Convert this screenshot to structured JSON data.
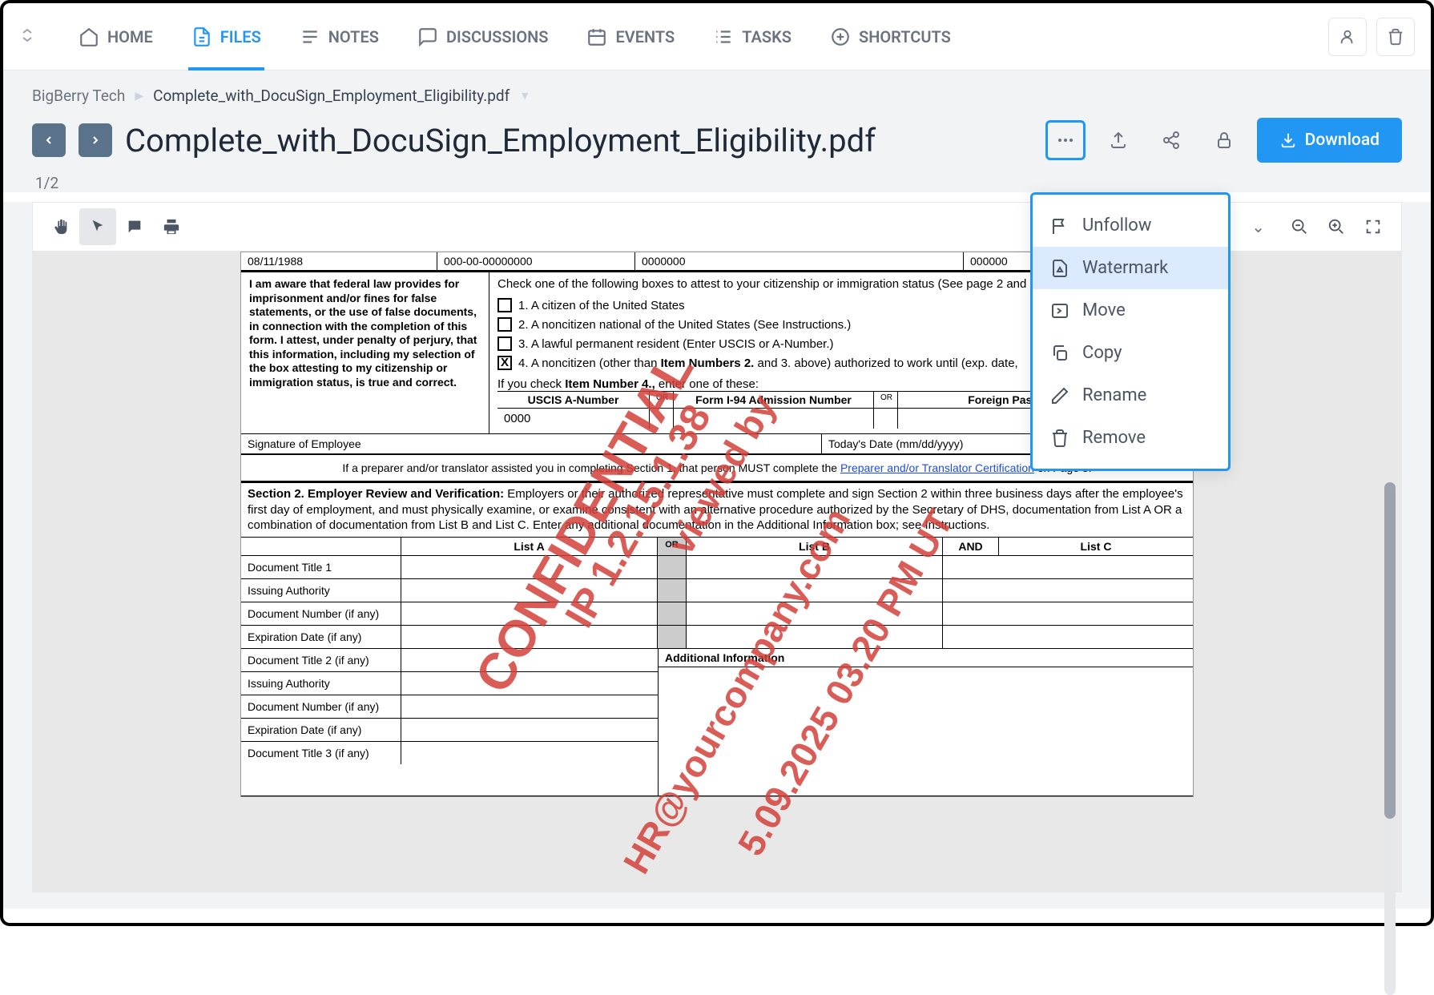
{
  "nav": {
    "home": "HOME",
    "files": "FILES",
    "notes": "NOTES",
    "discussions": "DISCUSSIONS",
    "events": "EVENTS",
    "tasks": "TASKS",
    "shortcuts": "SHORTCUTS"
  },
  "breadcrumb": {
    "root": "BigBerry Tech",
    "current": "Complete_with_DocuSign_Employment_Eligibility.pdf"
  },
  "page_title": "Complete_with_DocuSign_Employment_Eligibility.pdf",
  "page_counter": "1/2",
  "download_label": "Download",
  "context_menu": {
    "unfollow": "Unfollow",
    "watermark": "Watermark",
    "move": "Move",
    "copy": "Copy",
    "rename": "Rename",
    "remove": "Remove"
  },
  "doc": {
    "dob": "08/11/1988",
    "ssn": "000-00-00000000",
    "zero7": "0000000",
    "zero6": "000000",
    "attest_text": "I am aware that federal law provides for imprisonment and/or fines for false statements, or the use of false documents, in connection with the completion of this form. I attest, under penalty of perjury, that this information, including my selection of the box attesting to my citizenship or immigration status, is true and correct.",
    "check_intro": "Check one of the following boxes to attest to your citizenship or immigration status (See page 2 and 3",
    "opt1": "1.   A citizen of the United States",
    "opt2": "2.   A noncitizen national of the United States (See Instructions.)",
    "opt3": "3.   A lawful permanent resident (Enter USCIS or A-Number.)",
    "opt4_pre": "4.   A noncitizen (other than ",
    "opt4_bold": "Item Numbers 2.",
    "opt4_post": " and 3. above) authorized to work until (exp. date,",
    "item4_note_pre": "If you check ",
    "item4_note_bold": "Item Number 4.,",
    "item4_note_post": " enter one of these:",
    "uscis_hdr": "USCIS A-Number",
    "i94_hdr": "Form I-94 Admission Number",
    "passport_hdr": "Foreign Passport Number a",
    "or": "OR",
    "uscis_val": "0000",
    "sig_label": "Signature of Employee",
    "today_label": "Today's Date (mm/dd/yyyy)",
    "prep_pre": "If a preparer and/or translator assisted you in completing Section 1, that person MUST complete the ",
    "prep_link": "Preparer and/or Translator Certification",
    "prep_post": " on Page 3.",
    "sec2_head_bold": "Section 2. Employer Review and Verification:",
    "sec2_body": " Employers or their authorized representative must complete and sign Section 2 within three business days after the employee's first day of employment, and must physically examine, or examine consistent with an alternative procedure authorized by the Secretary of DHS, documentation from List A OR a combination of documentation from List B and List C. Enter any additional documentation in the Additional Information box; see Instructions.",
    "list_a": "List A",
    "list_b": "List B",
    "list_c": "List C",
    "and": "AND",
    "doc_title_1": "Document Title 1",
    "issuing_auth": "Issuing Authority",
    "doc_num": "Document Number (if any)",
    "exp_date": "Expiration Date (if any)",
    "doc_title_2": "Document Title 2 (if any)",
    "doc_title_3": "Document Title 3 (if any)",
    "addl_info": "Additional Information"
  },
  "watermarks": {
    "w1": "CONFIDENTIAL",
    "w2": "IP 1.2.15.1.38",
    "w3": "viewed by",
    "w4": "HR@yourcompany.com",
    "w5": "5.09.2025 03.20 PM UT"
  }
}
